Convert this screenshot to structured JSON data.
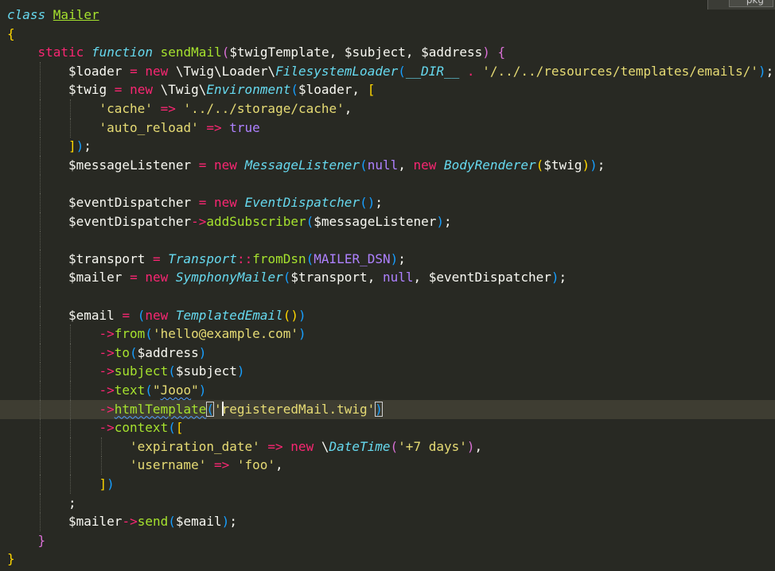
{
  "top_right_tab": {
    "label": "pkg"
  },
  "code": {
    "lines": [
      {
        "indent": 0,
        "tokens": [
          {
            "t": "class ",
            "c": "st",
            "n": "keyword-class"
          },
          {
            "t": "Mailer",
            "c": "fn under",
            "n": "class-name"
          }
        ]
      },
      {
        "indent": 0,
        "tokens": [
          {
            "t": "{",
            "c": "p1",
            "n": "brace"
          }
        ]
      },
      {
        "indent": 1,
        "tokens": [
          {
            "t": "static ",
            "c": "kw",
            "n": "keyword-static"
          },
          {
            "t": "function ",
            "c": "st",
            "n": "keyword-function"
          },
          {
            "t": "sendMail",
            "c": "fn",
            "n": "function-name"
          },
          {
            "t": "(",
            "c": "p2",
            "n": "paren"
          },
          {
            "t": "$twigTemplate, $subject, $address",
            "c": "pun",
            "n": "parameters"
          },
          {
            "t": ") ",
            "c": "p2",
            "n": "paren"
          },
          {
            "t": "{",
            "c": "p2",
            "n": "brace"
          }
        ]
      },
      {
        "indent": 2,
        "tokens": [
          {
            "t": "$loader ",
            "c": "pun",
            "n": "variable"
          },
          {
            "t": "= ",
            "c": "op",
            "n": "operator"
          },
          {
            "t": "new ",
            "c": "kw",
            "n": "keyword-new"
          },
          {
            "t": "\\Twig\\Loader\\",
            "c": "pun",
            "n": "namespace"
          },
          {
            "t": "FilesystemLoader",
            "c": "cls",
            "n": "class-ref"
          },
          {
            "t": "(",
            "c": "p3",
            "n": "paren"
          },
          {
            "t": "__DIR__",
            "c": "cls",
            "n": "magic-constant"
          },
          {
            "t": " . ",
            "c": "op",
            "n": "operator"
          },
          {
            "t": "'/../../resources/templates/emails/'",
            "c": "str",
            "n": "string"
          },
          {
            "t": ")",
            "c": "p3",
            "n": "paren"
          },
          {
            "t": ";",
            "c": "pun",
            "n": "semicolon"
          }
        ]
      },
      {
        "indent": 2,
        "tokens": [
          {
            "t": "$twig ",
            "c": "pun",
            "n": "variable"
          },
          {
            "t": "= ",
            "c": "op",
            "n": "operator"
          },
          {
            "t": "new ",
            "c": "kw",
            "n": "keyword-new"
          },
          {
            "t": "\\Twig\\",
            "c": "pun",
            "n": "namespace"
          },
          {
            "t": "Environment",
            "c": "cls",
            "n": "class-ref"
          },
          {
            "t": "(",
            "c": "p3",
            "n": "paren"
          },
          {
            "t": "$loader, ",
            "c": "pun",
            "n": "argument"
          },
          {
            "t": "[",
            "c": "p1",
            "n": "bracket"
          }
        ]
      },
      {
        "indent": 3,
        "tokens": [
          {
            "t": "'cache' ",
            "c": "str",
            "n": "string"
          },
          {
            "t": "=> ",
            "c": "op",
            "n": "operator"
          },
          {
            "t": "'../../storage/cache'",
            "c": "str",
            "n": "string"
          },
          {
            "t": ",",
            "c": "pun",
            "n": "comma"
          }
        ]
      },
      {
        "indent": 3,
        "tokens": [
          {
            "t": "'auto_reload' ",
            "c": "str",
            "n": "string"
          },
          {
            "t": "=> ",
            "c": "op",
            "n": "operator"
          },
          {
            "t": "true",
            "c": "con",
            "n": "constant"
          }
        ]
      },
      {
        "indent": 2,
        "tokens": [
          {
            "t": "]",
            "c": "p1",
            "n": "bracket"
          },
          {
            "t": ")",
            "c": "p3",
            "n": "paren"
          },
          {
            "t": ";",
            "c": "pun",
            "n": "semicolon"
          }
        ]
      },
      {
        "indent": 2,
        "tokens": [
          {
            "t": "$messageListener ",
            "c": "pun",
            "n": "variable"
          },
          {
            "t": "= ",
            "c": "op",
            "n": "operator"
          },
          {
            "t": "new ",
            "c": "kw",
            "n": "keyword-new"
          },
          {
            "t": "MessageListener",
            "c": "cls",
            "n": "class-ref"
          },
          {
            "t": "(",
            "c": "p3",
            "n": "paren"
          },
          {
            "t": "null",
            "c": "con",
            "n": "constant"
          },
          {
            "t": ", ",
            "c": "pun",
            "n": "comma"
          },
          {
            "t": "new ",
            "c": "kw",
            "n": "keyword-new"
          },
          {
            "t": "BodyRenderer",
            "c": "cls",
            "n": "class-ref"
          },
          {
            "t": "(",
            "c": "p1",
            "n": "paren"
          },
          {
            "t": "$twig",
            "c": "pun",
            "n": "argument"
          },
          {
            "t": ")",
            "c": "p1",
            "n": "paren"
          },
          {
            "t": ")",
            "c": "p3",
            "n": "paren"
          },
          {
            "t": ";",
            "c": "pun",
            "n": "semicolon"
          }
        ]
      },
      {
        "indent": 2,
        "tokens": []
      },
      {
        "indent": 2,
        "tokens": [
          {
            "t": "$eventDispatcher ",
            "c": "pun",
            "n": "variable"
          },
          {
            "t": "= ",
            "c": "op",
            "n": "operator"
          },
          {
            "t": "new ",
            "c": "kw",
            "n": "keyword-new"
          },
          {
            "t": "EventDispatcher",
            "c": "cls",
            "n": "class-ref"
          },
          {
            "t": "()",
            "c": "p3",
            "n": "paren"
          },
          {
            "t": ";",
            "c": "pun",
            "n": "semicolon"
          }
        ]
      },
      {
        "indent": 2,
        "tokens": [
          {
            "t": "$eventDispatcher",
            "c": "pun",
            "n": "variable"
          },
          {
            "t": "->",
            "c": "op",
            "n": "operator"
          },
          {
            "t": "addSubscriber",
            "c": "fn",
            "n": "method"
          },
          {
            "t": "(",
            "c": "p3",
            "n": "paren"
          },
          {
            "t": "$messageListener",
            "c": "pun",
            "n": "argument"
          },
          {
            "t": ")",
            "c": "p3",
            "n": "paren"
          },
          {
            "t": ";",
            "c": "pun",
            "n": "semicolon"
          }
        ]
      },
      {
        "indent": 2,
        "tokens": []
      },
      {
        "indent": 2,
        "tokens": [
          {
            "t": "$transport ",
            "c": "pun",
            "n": "variable"
          },
          {
            "t": "= ",
            "c": "op",
            "n": "operator"
          },
          {
            "t": "Transport",
            "c": "cls",
            "n": "class-ref"
          },
          {
            "t": "::",
            "c": "op",
            "n": "operator"
          },
          {
            "t": "fromDsn",
            "c": "fn",
            "n": "method"
          },
          {
            "t": "(",
            "c": "p3",
            "n": "paren"
          },
          {
            "t": "MAILER_DSN",
            "c": "con",
            "n": "constant"
          },
          {
            "t": ")",
            "c": "p3",
            "n": "paren"
          },
          {
            "t": ";",
            "c": "pun",
            "n": "semicolon"
          }
        ]
      },
      {
        "indent": 2,
        "tokens": [
          {
            "t": "$mailer ",
            "c": "pun",
            "n": "variable"
          },
          {
            "t": "= ",
            "c": "op",
            "n": "operator"
          },
          {
            "t": "new ",
            "c": "kw",
            "n": "keyword-new"
          },
          {
            "t": "SymphonyMailer",
            "c": "cls",
            "n": "class-ref"
          },
          {
            "t": "(",
            "c": "p3",
            "n": "paren"
          },
          {
            "t": "$transport, ",
            "c": "pun",
            "n": "argument"
          },
          {
            "t": "null",
            "c": "con",
            "n": "constant"
          },
          {
            "t": ", $eventDispatcher",
            "c": "pun",
            "n": "argument"
          },
          {
            "t": ")",
            "c": "p3",
            "n": "paren"
          },
          {
            "t": ";",
            "c": "pun",
            "n": "semicolon"
          }
        ]
      },
      {
        "indent": 2,
        "tokens": []
      },
      {
        "indent": 2,
        "tokens": [
          {
            "t": "$email ",
            "c": "pun",
            "n": "variable"
          },
          {
            "t": "= ",
            "c": "op",
            "n": "operator"
          },
          {
            "t": "(",
            "c": "p3",
            "n": "paren"
          },
          {
            "t": "new ",
            "c": "kw",
            "n": "keyword-new"
          },
          {
            "t": "TemplatedEmail",
            "c": "cls",
            "n": "class-ref"
          },
          {
            "t": "()",
            "c": "p1",
            "n": "paren"
          },
          {
            "t": ")",
            "c": "p3",
            "n": "paren"
          }
        ]
      },
      {
        "indent": 3,
        "tokens": [
          {
            "t": "->",
            "c": "op",
            "n": "operator"
          },
          {
            "t": "from",
            "c": "fn",
            "n": "method"
          },
          {
            "t": "(",
            "c": "p3",
            "n": "paren"
          },
          {
            "t": "'hello@example.com'",
            "c": "str",
            "n": "string"
          },
          {
            "t": ")",
            "c": "p3",
            "n": "paren"
          }
        ]
      },
      {
        "indent": 3,
        "tokens": [
          {
            "t": "->",
            "c": "op",
            "n": "operator"
          },
          {
            "t": "to",
            "c": "fn",
            "n": "method"
          },
          {
            "t": "(",
            "c": "p3",
            "n": "paren"
          },
          {
            "t": "$address",
            "c": "pun",
            "n": "argument"
          },
          {
            "t": ")",
            "c": "p3",
            "n": "paren"
          }
        ]
      },
      {
        "indent": 3,
        "tokens": [
          {
            "t": "->",
            "c": "op",
            "n": "operator"
          },
          {
            "t": "subject",
            "c": "fn",
            "n": "method"
          },
          {
            "t": "(",
            "c": "p3",
            "n": "paren"
          },
          {
            "t": "$subject",
            "c": "pun",
            "n": "argument"
          },
          {
            "t": ")",
            "c": "p3",
            "n": "paren"
          }
        ]
      },
      {
        "indent": 3,
        "tokens": [
          {
            "t": "->",
            "c": "op",
            "n": "operator"
          },
          {
            "t": "text",
            "c": "fn",
            "n": "method"
          },
          {
            "t": "(",
            "c": "p3",
            "n": "paren"
          },
          {
            "t": "\"",
            "c": "str",
            "n": "string"
          },
          {
            "t": "Jooo",
            "c": "str squiggle",
            "n": "string-misspelled"
          },
          {
            "t": "\"",
            "c": "str",
            "n": "string"
          },
          {
            "t": ")",
            "c": "p3",
            "n": "paren"
          }
        ]
      },
      {
        "indent": 3,
        "current": true,
        "tokens": [
          {
            "t": "->",
            "c": "op",
            "n": "operator"
          },
          {
            "t": "htmlTemplate",
            "c": "fn squiggle",
            "n": "method"
          },
          {
            "t": "(",
            "c": "p3 mark-box",
            "n": "paren"
          },
          {
            "t": "'",
            "c": "str",
            "n": "string"
          },
          {
            "t": "",
            "c": "cursor",
            "n": "text-cursor"
          },
          {
            "t": "registeredMail.twig'",
            "c": "str",
            "n": "string"
          },
          {
            "t": ")",
            "c": "p3 mark-box",
            "n": "paren"
          }
        ]
      },
      {
        "indent": 3,
        "tokens": [
          {
            "t": "->",
            "c": "op",
            "n": "operator"
          },
          {
            "t": "context",
            "c": "fn",
            "n": "method"
          },
          {
            "t": "(",
            "c": "p3",
            "n": "paren"
          },
          {
            "t": "[",
            "c": "p1",
            "n": "bracket"
          }
        ]
      },
      {
        "indent": 4,
        "tokens": [
          {
            "t": "'expiration_date' ",
            "c": "str",
            "n": "string"
          },
          {
            "t": "=> ",
            "c": "op",
            "n": "operator"
          },
          {
            "t": "new ",
            "c": "kw",
            "n": "keyword-new"
          },
          {
            "t": "\\",
            "c": "pun",
            "n": "namespace"
          },
          {
            "t": "DateTime",
            "c": "cls",
            "n": "class-ref"
          },
          {
            "t": "(",
            "c": "p2",
            "n": "paren"
          },
          {
            "t": "'+7 days'",
            "c": "str",
            "n": "string"
          },
          {
            "t": ")",
            "c": "p2",
            "n": "paren"
          },
          {
            "t": ",",
            "c": "pun",
            "n": "comma"
          }
        ]
      },
      {
        "indent": 4,
        "tokens": [
          {
            "t": "'username' ",
            "c": "str",
            "n": "string"
          },
          {
            "t": "=> ",
            "c": "op",
            "n": "operator"
          },
          {
            "t": "'foo'",
            "c": "str",
            "n": "string"
          },
          {
            "t": ",",
            "c": "pun",
            "n": "comma"
          }
        ]
      },
      {
        "indent": 3,
        "tokens": [
          {
            "t": "]",
            "c": "p1",
            "n": "bracket"
          },
          {
            "t": ")",
            "c": "p3",
            "n": "paren"
          }
        ]
      },
      {
        "indent": 2,
        "tokens": [
          {
            "t": ";",
            "c": "pun",
            "n": "semicolon"
          }
        ]
      },
      {
        "indent": 2,
        "tokens": [
          {
            "t": "$mailer",
            "c": "pun",
            "n": "variable"
          },
          {
            "t": "->",
            "c": "op",
            "n": "operator"
          },
          {
            "t": "send",
            "c": "fn",
            "n": "method"
          },
          {
            "t": "(",
            "c": "p3",
            "n": "paren"
          },
          {
            "t": "$email",
            "c": "pun",
            "n": "argument"
          },
          {
            "t": ")",
            "c": "p3",
            "n": "paren"
          },
          {
            "t": ";",
            "c": "pun",
            "n": "semicolon"
          }
        ]
      },
      {
        "indent": 1,
        "tokens": [
          {
            "t": "}",
            "c": "p2",
            "n": "brace"
          }
        ]
      },
      {
        "indent": 0,
        "tokens": [
          {
            "t": "}",
            "c": "p1",
            "n": "brace"
          }
        ]
      }
    ]
  }
}
